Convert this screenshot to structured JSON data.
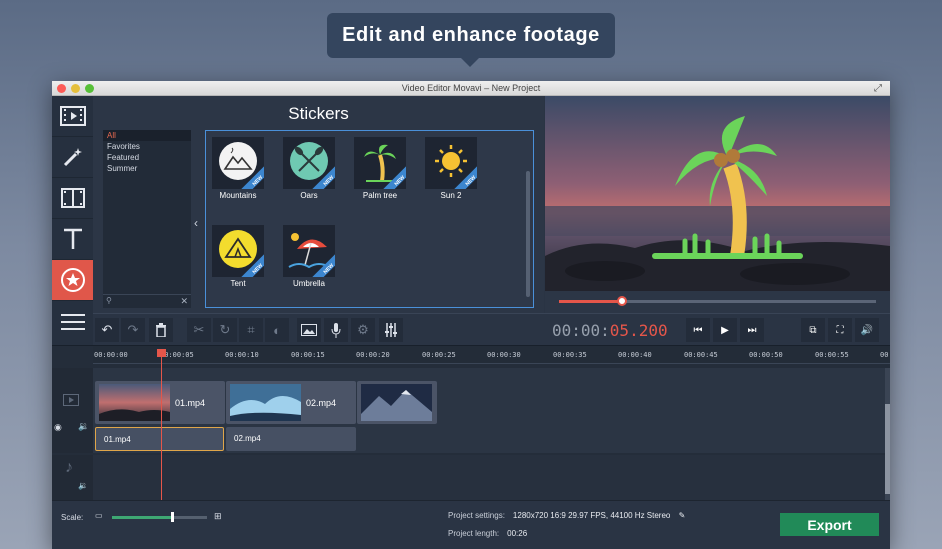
{
  "banner": {
    "text": "Edit and enhance footage"
  },
  "window": {
    "title": "Video Editor Movavi – New Project"
  },
  "sidebar": {
    "tools": [
      {
        "icon": "video-import-icon"
      },
      {
        "icon": "magic-wand-icon"
      },
      {
        "icon": "transitions-icon"
      },
      {
        "icon": "text-icon"
      },
      {
        "icon": "star-sticker-icon",
        "active": true
      },
      {
        "icon": "list-icon"
      }
    ]
  },
  "stickers": {
    "title": "Stickers",
    "categories": [
      "All",
      "Favorites",
      "Featured",
      "Summer"
    ],
    "items": [
      {
        "label": "Mountains",
        "new": "NEW"
      },
      {
        "label": "Oars",
        "new": "NEW"
      },
      {
        "label": "Palm tree",
        "new": "NEW"
      },
      {
        "label": "Sun 2",
        "new": "NEW"
      },
      {
        "label": "Tent",
        "new": "NEW"
      },
      {
        "label": "Umbrella",
        "new": "NEW"
      }
    ]
  },
  "player": {
    "progress": 0.2,
    "timecode_main": "00:00:",
    "timecode_accent": "05.200"
  },
  "toolbar": {
    "undo": "undo-icon",
    "redo": "redo-icon",
    "delete": "trash-icon",
    "cut": "scissors-icon",
    "rotate": "rotate-icon",
    "crop": "crop-icon",
    "color": "color-adjust-icon",
    "image": "image-icon",
    "mic": "microphone-icon",
    "settings": "gear-icon",
    "equalizer": "equalizer-icon"
  },
  "timeline": {
    "ticks": [
      "00:00:00",
      "00:00:05",
      "00:00:10",
      "00:00:15",
      "00:00:20",
      "00:00:25",
      "00:00:30",
      "00:00:35",
      "00:00:40",
      "00:00:45",
      "00:00:50",
      "00:00:55",
      "00:0"
    ],
    "video_clips": [
      {
        "label": "01.mp4"
      },
      {
        "label": "02.mp4"
      },
      {
        "label": ""
      }
    ],
    "audio_clips": [
      {
        "label": "01.mp4"
      },
      {
        "label": "02.mp4"
      }
    ]
  },
  "footer": {
    "scale_label": "Scale:",
    "scale_value": 0.62,
    "settings_label": "Project settings:",
    "settings_value": "1280x720 16:9 29.97 FPS, 44100 Hz Stereo",
    "length_label": "Project length:",
    "length_value": "00:26",
    "export_label": "Export"
  },
  "colors": {
    "accent_red": "#e5564a",
    "export_green": "#218a58",
    "selection_blue": "#4a90d9"
  }
}
